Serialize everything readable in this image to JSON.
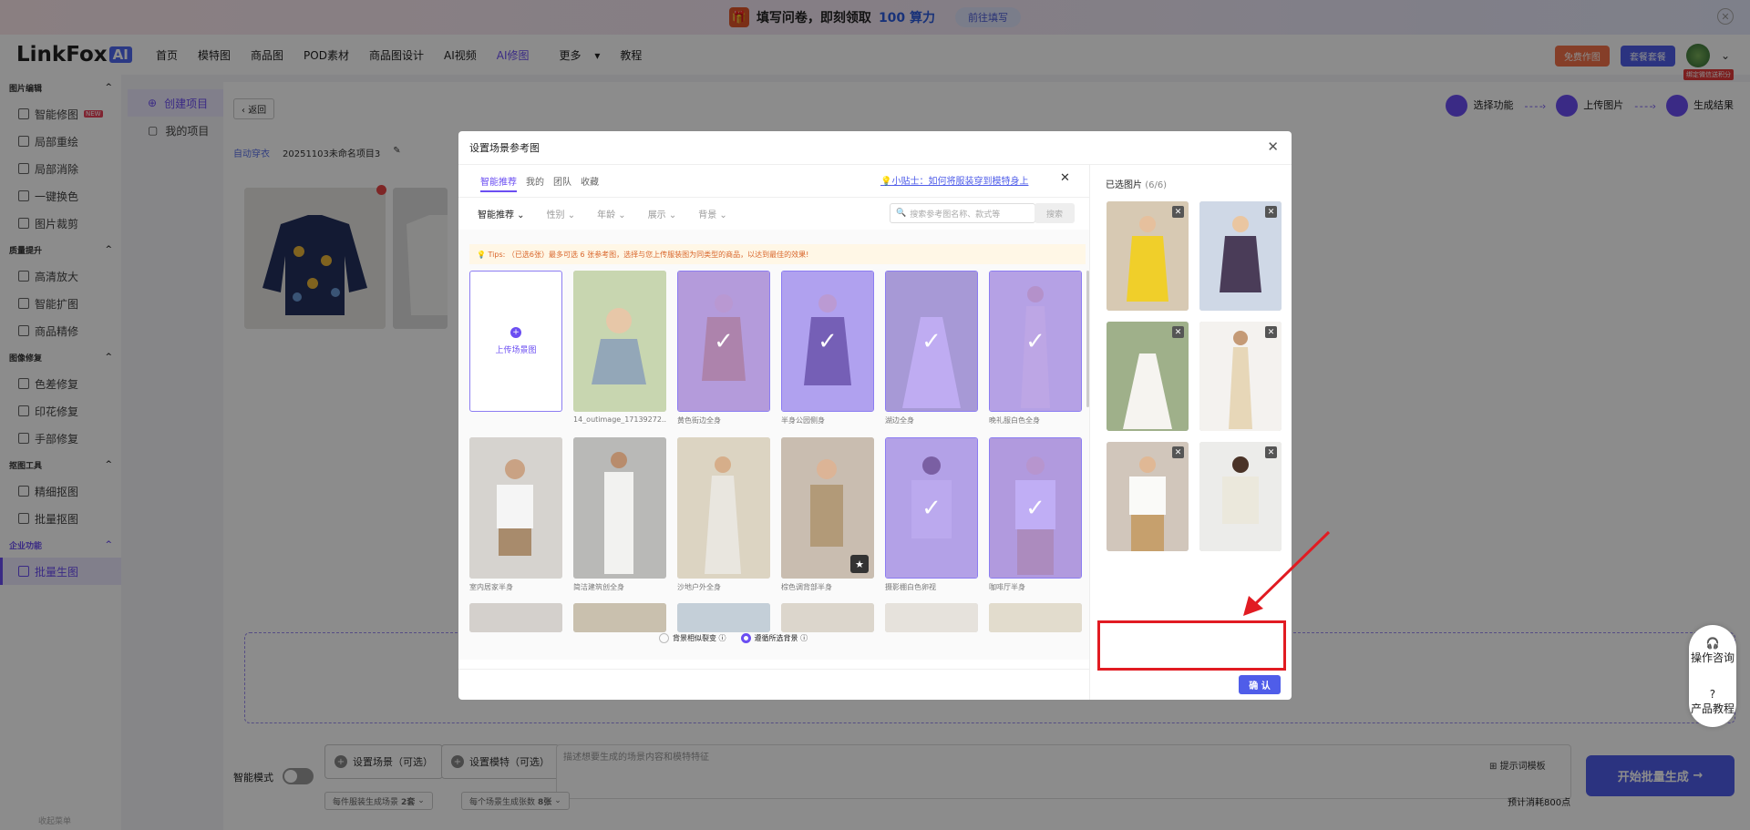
{
  "banner": {
    "text": "填写问卷，即刻领取",
    "amount": "100 算力",
    "button": "前往填写"
  },
  "brand": {
    "name": "LinkFox",
    "badge": "AI"
  },
  "nav": [
    "首页",
    "模特图",
    "商品图",
    "POD素材",
    "商品图设计",
    "AI视频",
    "AI修图",
    "更多",
    "教程"
  ],
  "nav_active": "AI修图",
  "header": {
    "free_btn": "免费作图",
    "plan_btn": "套餐套餐",
    "avatar_badge": "绑定微信送积分"
  },
  "sidebar": {
    "sections": [
      {
        "title": "图片编辑",
        "items": [
          "智能修图",
          "局部重绘",
          "局部消除",
          "一键换色",
          "图片裁剪"
        ],
        "new_badge": "NEW"
      },
      {
        "title": "质量提升",
        "items": [
          "高清放大",
          "智能扩图",
          "商品精修"
        ]
      },
      {
        "title": "图像修复",
        "items": [
          "色差修复",
          "印花修复",
          "手部修复"
        ]
      },
      {
        "title": "抠图工具",
        "items": [
          "精细抠图",
          "批量抠图"
        ]
      },
      {
        "title": "企业功能",
        "items": [
          "批量生图"
        ]
      }
    ],
    "active_item": "批量生图",
    "footer": "收起菜单"
  },
  "subnav": {
    "create": "创建项目",
    "mine": "我的项目"
  },
  "main": {
    "back": "返回",
    "tag": "自动穿衣",
    "project": "20251103未命名项目3",
    "steps": [
      "选择功能",
      "上传图片",
      "生成结果"
    ]
  },
  "bottom": {
    "mode_label": "智能模式",
    "scene_btn": "设置场景（可选）",
    "model_btn": "设置模特（可选）",
    "prompt_placeholder": "描述想要生成的场景内容和模特特征",
    "prompt_template": "提示词模板",
    "select1": "每件服装生成场景",
    "select1_val": "2套",
    "select2": "每个场景生成张数",
    "select2_val": "8张",
    "start": "开始批量生成",
    "cost": "预计消耗800点"
  },
  "modal": {
    "title": "设置场景参考图",
    "tabs": [
      "智能推荐",
      "我的",
      "团队",
      "收藏"
    ],
    "tip_link": "小贴士：如何将服装穿到模特身上",
    "filters": [
      "智能推荐",
      "性别",
      "年龄",
      "展示",
      "背景"
    ],
    "search_placeholder": "搜索参考图名称、款式等",
    "search_btn": "搜索",
    "tips": "Tips: （已选6张）最多可选 6 张参考图，选择与您上传服装图为同类型的商品，以达到最佳的效果!",
    "upload": "上传场景图",
    "row1": [
      "14_outimage_17139272...",
      "黄色街边全身",
      "半身公园侧身",
      "湖边全身",
      "晚礼服白色全身"
    ],
    "row2": [
      "室内居家半身",
      "简洁建筑创全身",
      "沙地户外全身",
      "棕色调背部半身",
      "摄影棚白色卵视",
      "咖啡厅半身"
    ],
    "selected_title": "已选图片",
    "selected_count": "(6/6)",
    "radio1": "背景相似裂变",
    "radio2": "遵循所选背景",
    "confirm": "确 认"
  },
  "help": {
    "ops": "操作咨询",
    "tutorial": "产品教程"
  }
}
